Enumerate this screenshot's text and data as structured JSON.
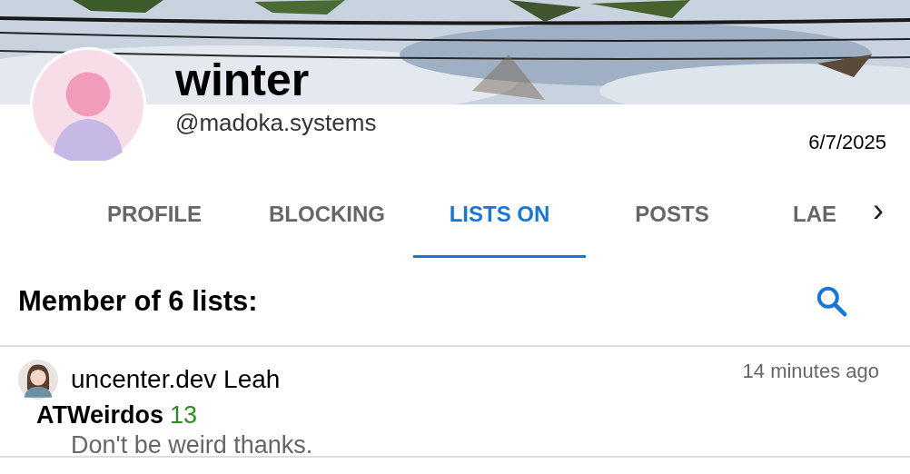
{
  "profile": {
    "name": "winter",
    "handle": "@madoka.systems",
    "date": "6/7/2025"
  },
  "tabs": [
    {
      "label": "PROFILE",
      "selected": false
    },
    {
      "label": "BLOCKING",
      "selected": false
    },
    {
      "label": "LISTS ON",
      "selected": true
    },
    {
      "label": "POSTS",
      "selected": false
    },
    {
      "label": "LAE",
      "selected": false
    }
  ],
  "tab_scroll": "›",
  "section": {
    "title": "Member of 6 lists:"
  },
  "lists": [
    {
      "owner": "uncenter.dev Leah",
      "time": "14 minutes ago",
      "name": "ATWeirdos",
      "count": "13",
      "description": "Don't be weird thanks."
    }
  ]
}
